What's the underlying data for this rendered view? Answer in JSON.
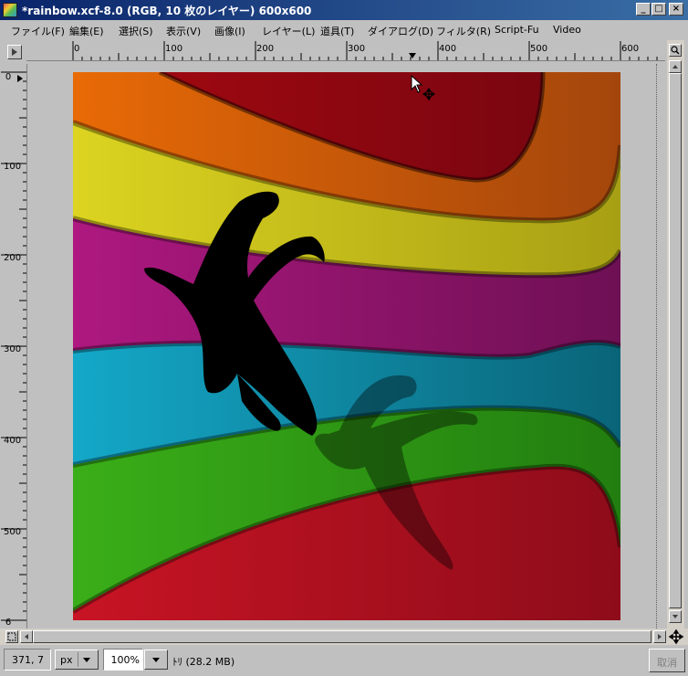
{
  "window": {
    "title": "*rainbow.xcf-8.0 (RGB, 10 枚のレイヤー) 600x600",
    "minimize_glyph": "_",
    "maximize_glyph": "□",
    "close_glyph": "×"
  },
  "menu": [
    "ファイル(F)",
    "編集(E)",
    "選択(S)",
    "表示(V)",
    "画像(I)",
    "レイヤー(L)",
    "道具(T)",
    "ダイアログ(D)",
    "フィルタ(R)",
    "Script-Fu",
    "Video"
  ],
  "ruler": {
    "h_labels": [
      "0",
      "100",
      "200",
      "300",
      "400",
      "500",
      "600"
    ],
    "v_labels": [
      "0",
      "100",
      "200",
      "300",
      "400",
      "500",
      "6"
    ]
  },
  "status": {
    "coords": "371, 7",
    "unit": "px",
    "zoom": "100%",
    "info": "ﾄﾘ (28.2 MB)",
    "cancel_label": "取消"
  },
  "colors": {
    "red": "#b51020",
    "orange": "#e46808",
    "yellow": "#d8d020",
    "magenta": "#a81878",
    "cyan": "#10a0c0",
    "green": "#30a818"
  }
}
